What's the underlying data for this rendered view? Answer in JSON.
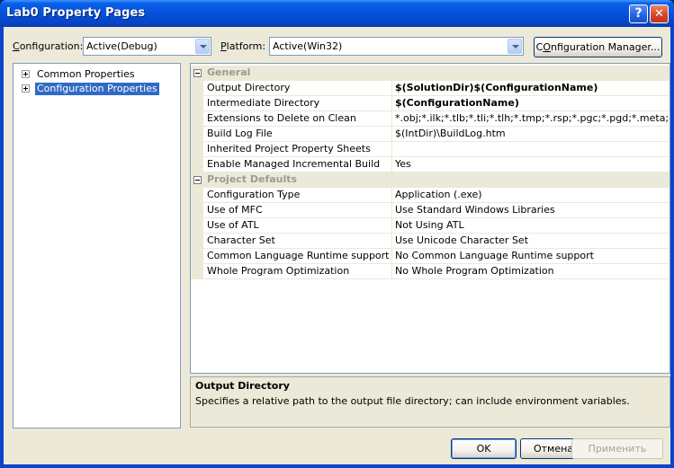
{
  "window": {
    "title": "Lab0 Property Pages"
  },
  "title_buttons": {
    "help": "?",
    "close": "✕"
  },
  "toolbar": {
    "configuration_label_pre": "",
    "configuration_label_u": "C",
    "configuration_label_post": "onfiguration:",
    "configuration_value": "Active(Debug)",
    "platform_label_u": "P",
    "platform_label_post": "latform:",
    "platform_value": "Active(Win32)",
    "config_manager_u": "O",
    "config_manager_post": "nfiguration Manager...",
    "config_manager_pre": "C"
  },
  "tree": {
    "items": [
      {
        "label": "Common Properties",
        "selected": false
      },
      {
        "label": "Configuration Properties",
        "selected": true
      }
    ]
  },
  "grid": {
    "categories": [
      {
        "label": "General",
        "rows": [
          {
            "name": "Output Directory",
            "value": "$(SolutionDir)$(ConfigurationName)",
            "bold": true
          },
          {
            "name": "Intermediate Directory",
            "value": "$(ConfigurationName)",
            "bold": true
          },
          {
            "name": "Extensions to Delete on Clean",
            "value": "*.obj;*.ilk;*.tlb;*.tli;*.tlh;*.tmp;*.rsp;*.pgc;*.pgd;*.meta;$(",
            "bold": false
          },
          {
            "name": "Build Log File",
            "value": "$(IntDir)\\BuildLog.htm",
            "bold": false
          },
          {
            "name": "Inherited Project Property Sheets",
            "value": "",
            "bold": false
          },
          {
            "name": "Enable Managed Incremental Build",
            "value": "Yes",
            "bold": false
          }
        ]
      },
      {
        "label": "Project Defaults",
        "rows": [
          {
            "name": "Configuration Type",
            "value": "Application (.exe)",
            "bold": false
          },
          {
            "name": "Use of MFC",
            "value": "Use Standard Windows Libraries",
            "bold": false
          },
          {
            "name": "Use of ATL",
            "value": "Not Using ATL",
            "bold": false
          },
          {
            "name": "Character Set",
            "value": "Use Unicode Character Set",
            "bold": false
          },
          {
            "name": "Common Language Runtime support",
            "value": "No Common Language Runtime support",
            "bold": false
          },
          {
            "name": "Whole Program Optimization",
            "value": "No Whole Program Optimization",
            "bold": false
          }
        ]
      }
    ]
  },
  "description": {
    "title": "Output Directory",
    "text": "Specifies a relative path to the output file directory; can include environment variables."
  },
  "buttons": {
    "ok": "OK",
    "cancel": "Отмена",
    "apply": "Применить"
  },
  "colors": {
    "selection": "#316ac5",
    "title_bar": "#0552d9",
    "dialog_face": "#ece9d8"
  }
}
